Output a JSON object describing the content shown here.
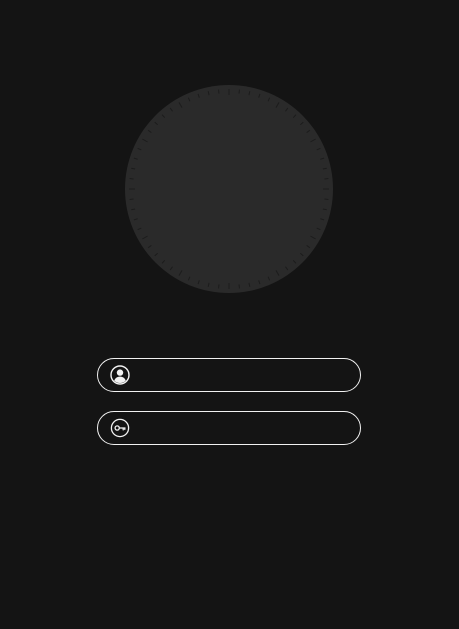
{
  "colors": {
    "background": "#141414",
    "dial_fill": "#2a2a2a",
    "dial_ticks": "#1c1c1c",
    "field_border": "#f2f2f2",
    "icon": "#f2f2f2"
  },
  "login": {
    "avatar_icon": "dial-avatar",
    "username": {
      "icon": "user-circle-icon",
      "value": "",
      "placeholder": ""
    },
    "password": {
      "icon": "key-icon",
      "value": "",
      "placeholder": ""
    }
  }
}
